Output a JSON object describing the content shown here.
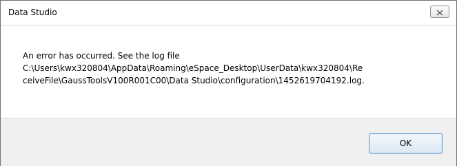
{
  "window": {
    "title": "Data Studio",
    "close_icon": "close-x-icon"
  },
  "message": {
    "lines": [
      "An error has occurred. See the log file",
      "C:\\Users\\kwx320804\\AppData\\Roaming\\eSpace_Desktop\\UserData\\kwx320804\\Re",
      "ceiveFile\\GaussToolsV100R001C00\\Data Studio\\configuration\\1452619704192.log."
    ]
  },
  "buttons": {
    "ok_label": "OK"
  },
  "colors": {
    "accent_border": "#6b9acb",
    "footer_bg": "#f0f0f0"
  }
}
